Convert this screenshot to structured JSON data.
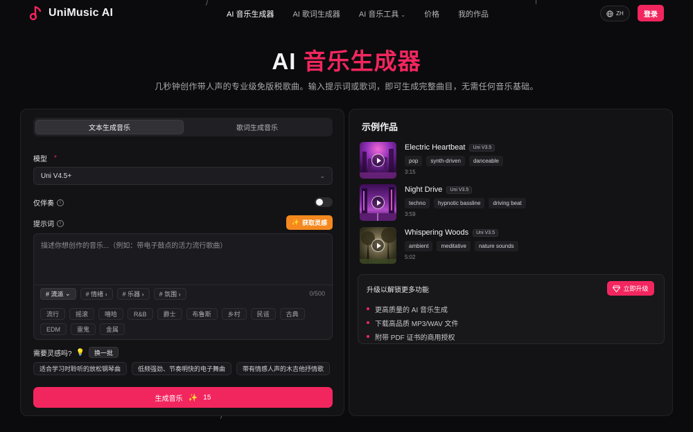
{
  "brand": {
    "name": "UniMusic AI",
    "color": "#f2265f",
    "icon": "music-note-icon"
  },
  "nav": {
    "links": [
      {
        "label": "AI 音乐生成器",
        "active": true
      },
      {
        "label": "AI 歌词生成器",
        "active": false
      },
      {
        "label": "AI 音乐工具",
        "active": false,
        "dropdown": true
      },
      {
        "label": "价格",
        "active": false
      },
      {
        "label": "我的作品",
        "active": false
      }
    ],
    "lang": "ZH",
    "login": "登录"
  },
  "hero": {
    "title_prefix": "AI",
    "title_accent": "音乐生成器",
    "subtitle": "几秒钟创作带人声的专业级免版税歌曲。输入提示词或歌词，即可生成完整曲目，无需任何音乐基础。"
  },
  "generator": {
    "tabs": [
      {
        "label": "文本生成音乐",
        "active": true
      },
      {
        "label": "歌词生成音乐",
        "active": false
      }
    ],
    "model_label": "模型",
    "model_required": "*",
    "model_value": "Uni V4.5+",
    "instrumental_label": "仅伴奏",
    "instrumental_on": false,
    "prompt_label": "提示词",
    "inspire_button": "获取灵感",
    "prompt_placeholder": "描述你想创作的音乐...（例如：带电子鼓点的活力流行歌曲）",
    "char_count": "0/500",
    "categories": [
      {
        "label": "# 流派",
        "chev": "⌄",
        "active": true
      },
      {
        "label": "# 情绪",
        "chev": "›",
        "active": false
      },
      {
        "label": "# 乐器",
        "chev": "›",
        "active": false
      },
      {
        "label": "# 氛围",
        "chev": "›",
        "active": false
      }
    ],
    "genres": [
      "流行",
      "摇滚",
      "嘻哈",
      "R&B",
      "爵士",
      "布鲁斯",
      "乡村",
      "民谣",
      "古典",
      "EDM",
      "雷鬼",
      "金属"
    ],
    "need_inspiration": "需要灵感吗?",
    "refresh_button": "换一批",
    "suggestions": [
      "适合学习时聆听的放松钢琴曲",
      "低频强劲、节奏明快的电子舞曲",
      "带有情感人声的木吉他抒情歌"
    ],
    "generate_button": "生成音乐",
    "generate_cost": "15"
  },
  "examples": {
    "title": "示例作品",
    "tracks": [
      {
        "name": "Electric Heartbeat",
        "version": "Uni V3.5",
        "tags": [
          "pop",
          "synth-driven",
          "danceable"
        ],
        "duration": "3:15"
      },
      {
        "name": "Night Drive",
        "version": "Uni V3.5",
        "tags": [
          "techno",
          "hypnotic bassline",
          "driving beat"
        ],
        "duration": "3:59"
      },
      {
        "name": "Whispering Woods",
        "version": "Uni V3.5",
        "tags": [
          "ambient",
          "meditative",
          "nature sounds"
        ],
        "duration": "5:02"
      }
    ]
  },
  "upgrade": {
    "title": "升级以解锁更多功能",
    "button": "立即升级",
    "features": [
      "更高质量的 AI 音乐生成",
      "下载高品质 MP3/WAV 文件",
      "附带 PDF 证书的商用授权"
    ]
  }
}
